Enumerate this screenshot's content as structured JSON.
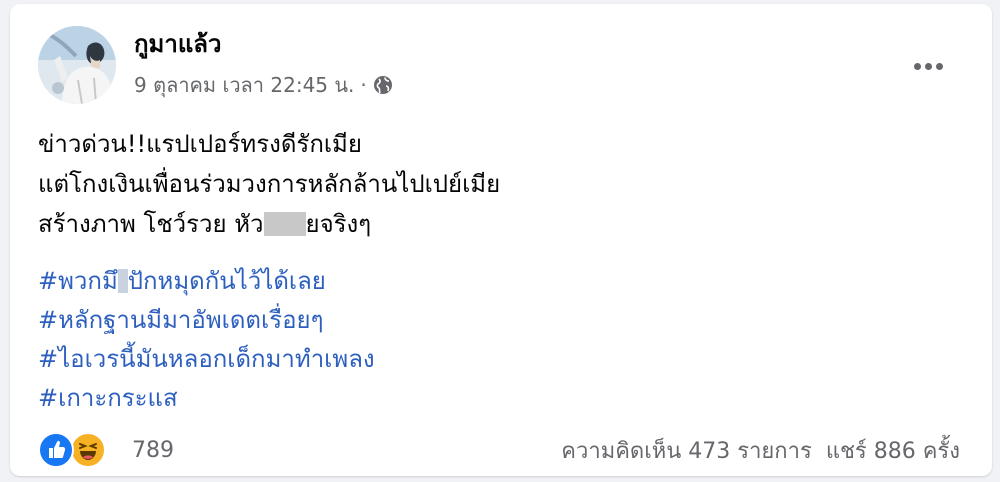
{
  "post": {
    "author": "กูมาแล้ว",
    "timestamp": "9 ตุลาคม เวลา 22:45 น.",
    "separator": "·",
    "privacy_icon": "globe-icon",
    "more_icon": "more-options-icon",
    "body_lines": [
      "ข่าวด่วน!!แรปเปอร์ทรงดีรักเมีย",
      "แต่โกงเงินเพื่อนร่วมวงการหลักล้านไปเปย์เมีย"
    ],
    "body_line3": {
      "before": "สร้างภาพ โชว์รวย หัว",
      "after": "ยจริงๆ"
    },
    "hashtag1": {
      "before": "#พวกมึ",
      "after": "ปักหมุดกันไว้ได้เลย"
    },
    "hashtags": [
      "#หลักฐานมีมาอัพเดตเรื่อยๆ",
      "#ไอเวรนี้มันหลอกเด็กมาทำเพลง",
      "#เกาะกระแส"
    ],
    "link_color": "#2d5fbf"
  },
  "footer": {
    "reaction_icons": [
      "like-icon",
      "haha-icon"
    ],
    "reaction_count": "789",
    "comments": "ความคิดเห็น 473 รายการ",
    "shares": "แชร์ 886 ครั้ง"
  }
}
